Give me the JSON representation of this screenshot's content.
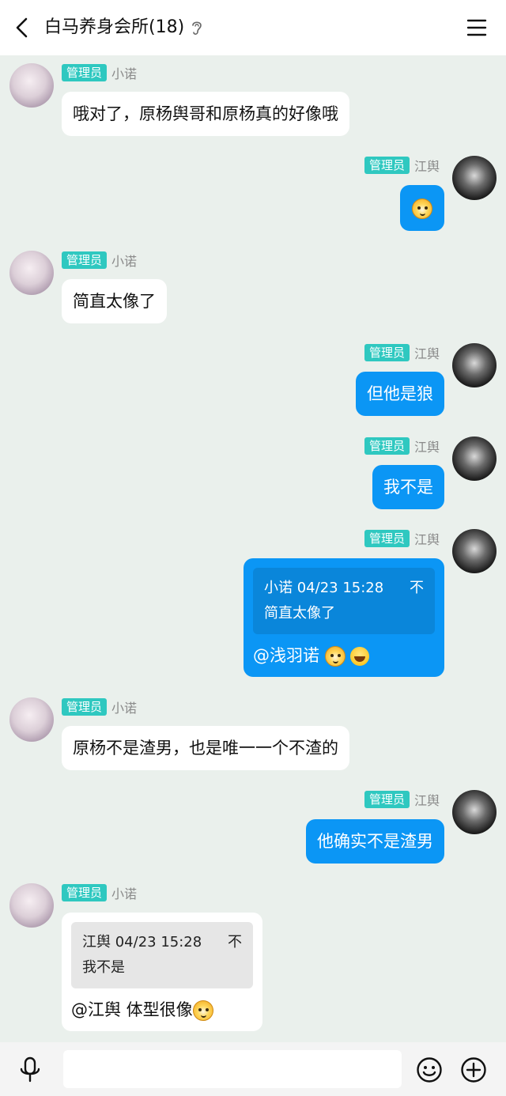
{
  "header": {
    "title": "白马养身会所(18)",
    "back_icon": "chevron-left-icon",
    "ear_icon": "ear-icon",
    "menu_icon": "hamburger-menu-icon"
  },
  "badge_label": "管理员",
  "colors": {
    "badge": "#2fc8c0",
    "outgoing_bubble": "#0b96f5",
    "background": "#eaf0ec"
  },
  "messages": [
    {
      "from": "小诺",
      "side": "in",
      "text": "哦对了，原杨舆哥和原杨真的好像哦"
    },
    {
      "from": "江舆",
      "side": "out",
      "emoji": "tiger-emoji"
    },
    {
      "from": "小诺",
      "side": "in",
      "text": "简直太像了"
    },
    {
      "from": "江舆",
      "side": "out",
      "text": "但他是狼"
    },
    {
      "from": "江舆",
      "side": "out",
      "text": "我不是"
    },
    {
      "from": "江舆",
      "side": "out",
      "quote": {
        "header": "小诺 04/23 15:28",
        "close": "不",
        "body": "简直太像了"
      },
      "text": "@浅羽诺 "
    },
    {
      "from": "小诺",
      "side": "in",
      "text": "原杨不是渣男，也是唯一一个不渣的"
    },
    {
      "from": "江舆",
      "side": "out",
      "text": "他确实不是渣男"
    },
    {
      "from": "小诺",
      "side": "in",
      "quote": {
        "header": "江舆 04/23 15:28",
        "close": "不",
        "body": "我不是"
      },
      "text": "@江舆 体型很像"
    }
  ],
  "input": {
    "value": "",
    "mic_icon": "microphone-icon",
    "emoji_icon": "smiley-icon",
    "plus_icon": "plus-circle-icon"
  }
}
